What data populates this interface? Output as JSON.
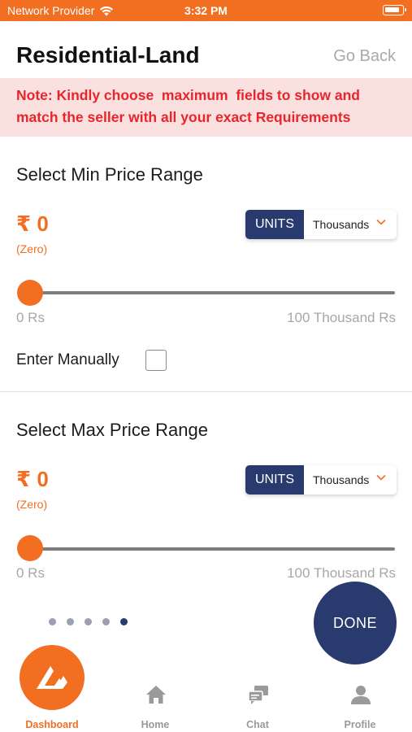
{
  "status_bar": {
    "carrier": "Network Provider",
    "time": "3:32 PM"
  },
  "header": {
    "title": "Residential-Land",
    "go_back": "Go Back"
  },
  "note": "Note: Kindly choose  maximum  fields to show and\nmatch the seller with all your exact Requirements",
  "min_price": {
    "title": "Select Min Price Range",
    "value": "₹ 0",
    "words": "(Zero)",
    "units_label": "UNITS",
    "units_value": "Thousands",
    "slider_position": 0,
    "range_min": "0 Rs",
    "range_max": "100 Thousand Rs",
    "manual_label": "Enter Manually",
    "manual_checked": false
  },
  "max_price": {
    "title": "Select Max Price Range",
    "value": "₹ 0",
    "words": "(Zero)",
    "units_label": "UNITS",
    "units_value": "Thousands",
    "slider_position": 0,
    "range_min": "0 Rs",
    "range_max": "100 Thousand Rs"
  },
  "pager": {
    "total": 5,
    "active_index": 4
  },
  "done_label": "DONE",
  "tabs": [
    {
      "label": "Dashboard",
      "icon": "dashboard-logo-icon",
      "active": true
    },
    {
      "label": "Home",
      "icon": "home-icon",
      "active": false
    },
    {
      "label": "Chat",
      "icon": "chat-icon",
      "active": false
    },
    {
      "label": "Profile",
      "icon": "profile-icon",
      "active": false
    }
  ],
  "colors": {
    "accent": "#f26f21",
    "navy": "#283a6e",
    "note_text": "#e8252b",
    "note_bg": "#fbe0e0"
  }
}
